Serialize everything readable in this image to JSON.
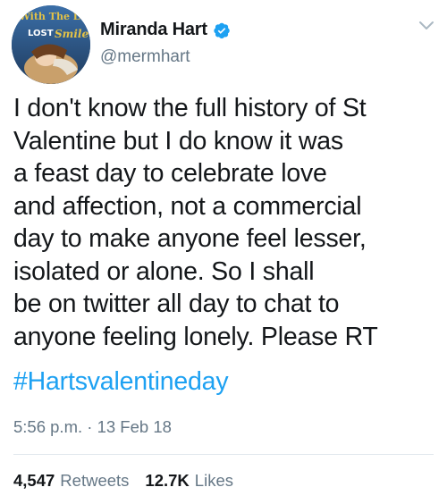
{
  "author": {
    "display_name": "Miranda Hart",
    "handle": "@mermhart",
    "verified": true,
    "avatar_text": "The Girl With The Lost Smile"
  },
  "tweet": {
    "text": "I don't know the full history of St\nValentine but I do know it was\na feast day to celebrate love\nand affection, not a commercial\nday to make anyone feel lesser,\nisolated or alone. So I shall\nbe on twitter all day to chat to\nanyone feeling lonely. Please RT",
    "hashtag": "#Hartsvalentineday",
    "time": "5:56 p.m.",
    "separator": "·",
    "date": "13 Feb 18"
  },
  "stats": {
    "retweets_count": "4,547",
    "retweets_label": "Retweets",
    "likes_count": "12.7K",
    "likes_label": "Likes"
  },
  "colors": {
    "accent": "#1da1f2",
    "muted": "#657786",
    "text": "#14171a",
    "divider": "#e1e8ed"
  },
  "icons": {
    "verified": "verified-badge-icon",
    "menu": "chevron-down-icon"
  }
}
